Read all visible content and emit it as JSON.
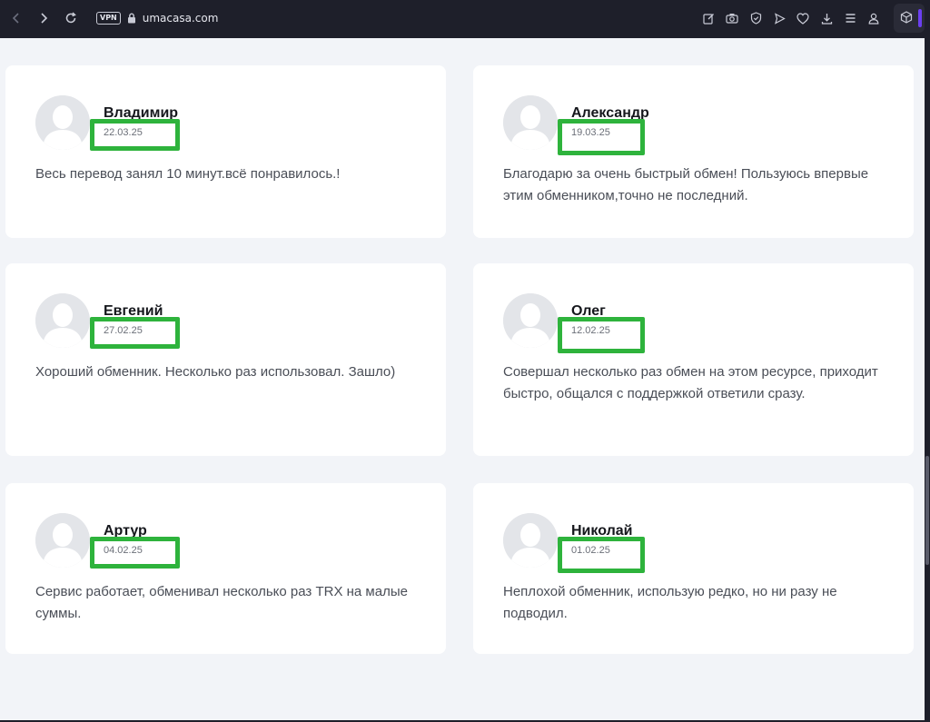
{
  "browser": {
    "url": "umacasa.com",
    "vpn_label": "VPN",
    "accent_color": "#6b3ff0"
  },
  "toolbar_icons": [
    "back-icon",
    "forward-icon",
    "reload-icon",
    "edit-icon",
    "camera-icon",
    "shield-icon",
    "send-icon",
    "heart-icon",
    "download-icon",
    "menu-icon",
    "profile-icon",
    "cube-icon"
  ],
  "highlight_color": "#2eb33c",
  "reviews": [
    {
      "name": "Владимир",
      "date": "22.03.25",
      "text": "Весь перевод занял 10 минут.всё понравилось.!"
    },
    {
      "name": "Александр",
      "date": "19.03.25",
      "text": "Благодарю за очень быстрый обмен! Пользуюсь впервые этим обменником,точно не последний."
    },
    {
      "name": "Евгений",
      "date": "27.02.25",
      "text": "Хороший обменник. Несколько раз использовал. Зашло)"
    },
    {
      "name": "Олег",
      "date": "12.02.25",
      "text": "Совершал несколько раз обмен на этом ресурсе, приходит быстро, общался с поддержкой ответили сразу."
    },
    {
      "name": "Артур",
      "date": "04.02.25",
      "text": "Сервис работает, обменивал несколько раз TRX на малые суммы."
    },
    {
      "name": "Николай",
      "date": "01.02.25",
      "text": "Неплохой обменник, использую редко, но ни разу не подводил."
    }
  ]
}
